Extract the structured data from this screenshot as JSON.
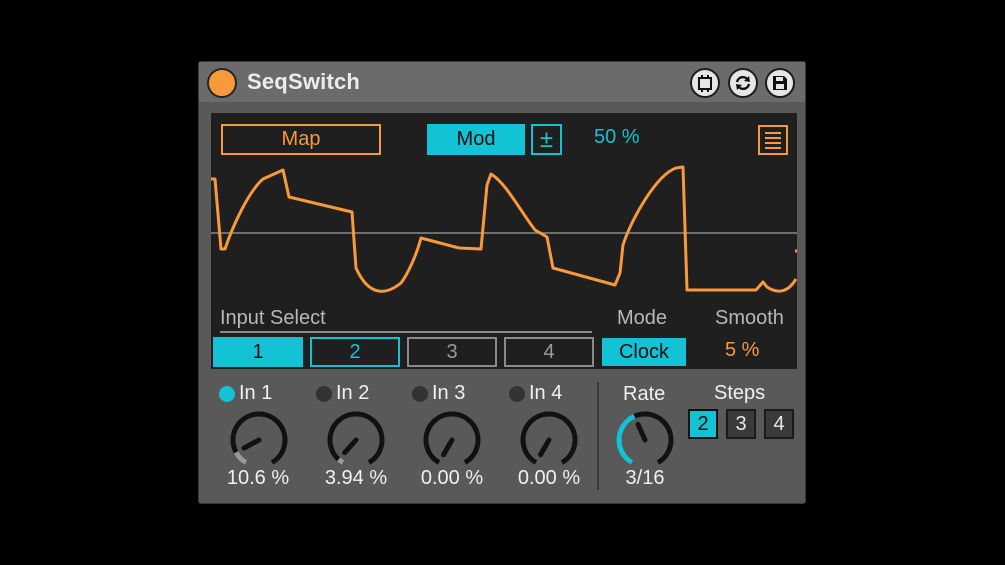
{
  "title": "SeqSwitch",
  "colors": {
    "accent_cyan": "#14c2d6",
    "accent_orange": "#f79a3c",
    "panel": "#595959",
    "display": "#1f1f1f"
  },
  "titlebar": {
    "icons": [
      "power-icon",
      "midi-map-icon",
      "refresh-icon",
      "save-icon"
    ]
  },
  "display": {
    "map_label": "Map",
    "mod_label": "Mod",
    "plusminus_label": "±",
    "mod_amount": "50 %",
    "menu_icon": "list-icon"
  },
  "input_select": {
    "label": "Input Select",
    "options": [
      "1",
      "2",
      "3",
      "4"
    ],
    "selected": "1"
  },
  "mode": {
    "label": "Mode",
    "value": "Clock"
  },
  "smooth": {
    "label": "Smooth",
    "value": "5 %"
  },
  "inputs": [
    {
      "label": "In 1",
      "active": true,
      "value": "10.6 %",
      "amount": 0.106
    },
    {
      "label": "In 2",
      "active": false,
      "value": "3.94 %",
      "amount": 0.0394
    },
    {
      "label": "In 3",
      "active": false,
      "value": "0.00 %",
      "amount": 0.0
    },
    {
      "label": "In 4",
      "active": false,
      "value": "0.00 %",
      "amount": 0.0
    }
  ],
  "rate": {
    "label": "Rate",
    "value": "3/16",
    "amount": 0.42
  },
  "steps": {
    "label": "Steps",
    "options": [
      "2",
      "3",
      "4"
    ],
    "selected": "2"
  }
}
